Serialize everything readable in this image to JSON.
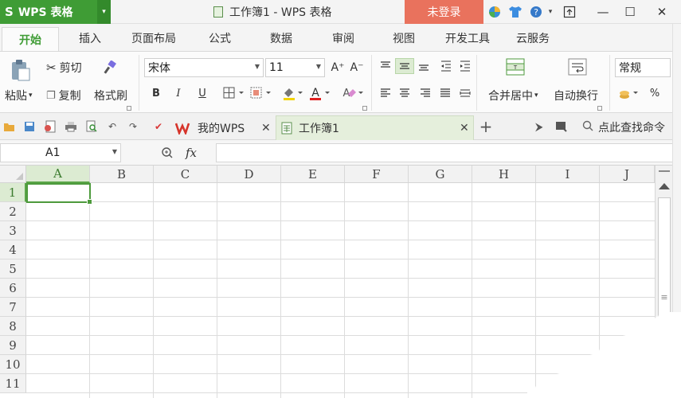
{
  "titlebar": {
    "app_logo": "S",
    "app_name": "WPS 表格",
    "app_dropdown": "▾",
    "window_title": "工作簿1 - WPS 表格",
    "login_label": "未登录",
    "icons": [
      "browser-icon",
      "skin-icon",
      "help-icon"
    ],
    "help_dropdown": "▾",
    "controls": {
      "restore": "⤒",
      "minimize": "—",
      "maximize": "☐",
      "close": "✕"
    }
  },
  "menu": {
    "tabs": [
      "开始",
      "插入",
      "页面布局",
      "公式",
      "数据",
      "审阅",
      "视图",
      "开发工具",
      "云服务"
    ],
    "active": "开始"
  },
  "ribbon": {
    "paste": "粘贴",
    "paste_drop": "▾",
    "cut": "剪切",
    "copy": "复制",
    "format_painter": "格式刷",
    "font_name": "宋体",
    "font_size": "11",
    "increase_font": "A⁺",
    "decrease_font": "A⁻",
    "bold": "B",
    "italic": "I",
    "underline": "U",
    "merge_center": "合并居中",
    "merge_drop": "▾",
    "wrap_text": "自动换行",
    "number_format": "常规",
    "percent": "%"
  },
  "quickbar": {
    "tabs": [
      {
        "label": "我的WPS",
        "close": "✕"
      },
      {
        "label": "工作簿1",
        "close": "✕"
      }
    ],
    "new_tab": "+",
    "search_label": "点此查找命令"
  },
  "formula_bar": {
    "cell_ref": "A1",
    "fx": "fx",
    "value": ""
  },
  "grid": {
    "columns": [
      "A",
      "B",
      "C",
      "D",
      "E",
      "F",
      "G",
      "H",
      "I",
      "J"
    ],
    "rows": [
      "1",
      "2",
      "3",
      "4",
      "5",
      "6",
      "7",
      "8",
      "9",
      "10",
      "11"
    ],
    "selected_cell": "A1"
  },
  "colors": {
    "accent_green": "#3f9c35",
    "login_orange": "#e9725d",
    "selection_fill": "#dcebd2"
  }
}
